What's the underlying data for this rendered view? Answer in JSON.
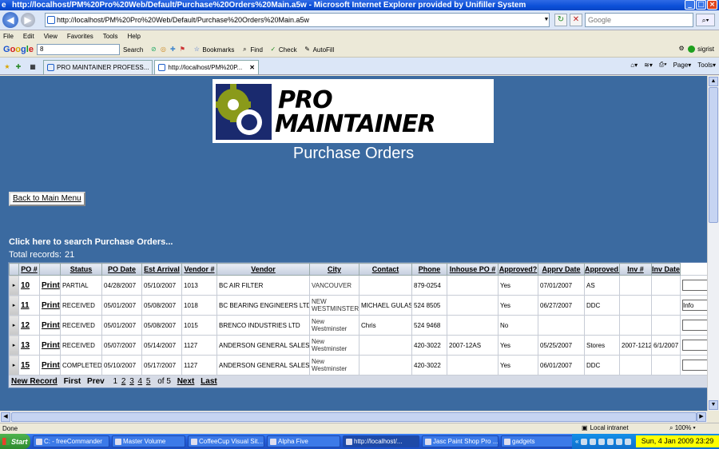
{
  "window": {
    "title": "http://localhost/PM%20Pro%20Web/Default/Purchase%20Orders%20Main.a5w - Microsoft Internet Explorer provided by Unifiller System",
    "btn_min": "_",
    "btn_max": "□",
    "btn_close": "×"
  },
  "address_bar": {
    "url": "http://localhost/PM%20Pro%20Web/Default/Purchase%20Orders%20Main.a5w",
    "search_placeholder": "Google"
  },
  "menu": [
    "File",
    "Edit",
    "View",
    "Favorites",
    "Tools",
    "Help"
  ],
  "google_toolbar": {
    "logo": [
      "G",
      "o",
      "o",
      "g",
      "l",
      "e"
    ],
    "query": "8",
    "search_label": "Search",
    "bookmarks_label": "Bookmarks",
    "find_label": "Find",
    "check_label": "Check",
    "autofill_label": "AutoFill",
    "user": "sigrist"
  },
  "tabs": [
    {
      "label": "PRO MAINTAINER PROFESS...",
      "active": false
    },
    {
      "label": "http://localhost/PM%20P...",
      "active": true
    }
  ],
  "command_bar": {
    "page_label": "Page",
    "tools_label": "Tools"
  },
  "page": {
    "logo_line1": "PRO",
    "logo_line2": "MAINTAINER",
    "title": "Purchase Orders",
    "back_button": "Back to Main Menu",
    "search_link": "Click here to search Purchase Orders...",
    "total_label": "Total records:",
    "total_value": "21"
  },
  "grid": {
    "columns": [
      "PO #",
      "Status",
      "PO Date",
      "Est Arrival",
      "Vendor #",
      "Vendor",
      "City",
      "Contact",
      "Phone",
      "Inhouse PO #",
      "Approved?",
      "Apprv Date",
      "Approved By",
      "Inv #",
      "Inv Date"
    ],
    "print_label": "Print",
    "rows": [
      {
        "po": "10",
        "status": "PARTIAL",
        "po_date": "04/28/2007",
        "est_arrival": "05/10/2007",
        "vendor_no": "1013",
        "vendor": "BC AIR FILTER",
        "city": "VANCOUVER",
        "contact": "",
        "phone": "879-0254",
        "inhouse_po": "",
        "approved": "Yes",
        "apprv_date": "07/01/2007",
        "approved_by": "AS",
        "inv_no": "",
        "inv_date": "",
        "extra": ""
      },
      {
        "po": "11",
        "status": "RECEIVED",
        "po_date": "05/01/2007",
        "est_arrival": "05/08/2007",
        "vendor_no": "1018",
        "vendor": "BC BEARING ENGINEERS LTD",
        "city": "NEW WESTMINSTER",
        "contact": "MICHAEL GULAS",
        "phone": "524 8505",
        "inhouse_po": "",
        "approved": "Yes",
        "apprv_date": "06/27/2007",
        "approved_by": "DDC",
        "inv_no": "",
        "inv_date": "",
        "extra": "Info"
      },
      {
        "po": "12",
        "status": "RECEIVED",
        "po_date": "05/01/2007",
        "est_arrival": "05/08/2007",
        "vendor_no": "1015",
        "vendor": "BRENCO INDUSTRIES LTD",
        "city": "New Westminster",
        "contact": "Chris",
        "phone": "524 9468",
        "inhouse_po": "",
        "approved": "No",
        "apprv_date": "",
        "approved_by": "",
        "inv_no": "",
        "inv_date": "",
        "extra": ""
      },
      {
        "po": "13",
        "status": "RECEIVED",
        "po_date": "05/07/2007",
        "est_arrival": "05/14/2007",
        "vendor_no": "1127",
        "vendor": "ANDERSON GENERAL SALES",
        "city": "New Westminster",
        "contact": "",
        "phone": "420-3022",
        "inhouse_po": "2007-12AS",
        "approved": "Yes",
        "apprv_date": "05/25/2007",
        "approved_by": "Stores",
        "inv_no": "2007-1212",
        "inv_date": "6/1/2007",
        "extra": ""
      },
      {
        "po": "15",
        "status": "COMPLETED",
        "po_date": "05/10/2007",
        "est_arrival": "05/17/2007",
        "vendor_no": "1127",
        "vendor": "ANDERSON GENERAL SALES",
        "city": "New Westminster",
        "contact": "",
        "phone": "420-3022",
        "inhouse_po": "",
        "approved": "Yes",
        "apprv_date": "06/01/2007",
        "approved_by": "DDC",
        "inv_no": "",
        "inv_date": "",
        "extra": ""
      }
    ],
    "footer": {
      "new_record": "New Record",
      "first": "First",
      "prev": "Prev",
      "pages": [
        "1",
        "2",
        "3",
        "4",
        "5"
      ],
      "of_label": "of 5",
      "next": "Next",
      "last": "Last"
    }
  },
  "status_bar": {
    "status": "Done",
    "zone": "Local intranet",
    "zoom": "100%"
  },
  "taskbar": {
    "start": "Start",
    "tasks": [
      {
        "label": "C: - freeCommander",
        "active": false
      },
      {
        "label": "Master Volume",
        "active": false
      },
      {
        "label": "CoffeeCup Visual Sit...",
        "active": false
      },
      {
        "label": "Alpha Five",
        "active": false
      },
      {
        "label": "http://localhost/...",
        "active": true
      },
      {
        "label": "Jasc Paint Shop Pro ...",
        "active": false
      },
      {
        "label": "gadgets",
        "active": false
      }
    ],
    "clock": "Sun, 4 Jan 2009  23:29"
  },
  "colors": {
    "page_background": "#3b6aa0",
    "title_bar": "#0b4fd8",
    "clock_highlight": "#ffff00",
    "logo_gear": "#8a9a1a",
    "logo_navy": "#1a2a6e"
  }
}
